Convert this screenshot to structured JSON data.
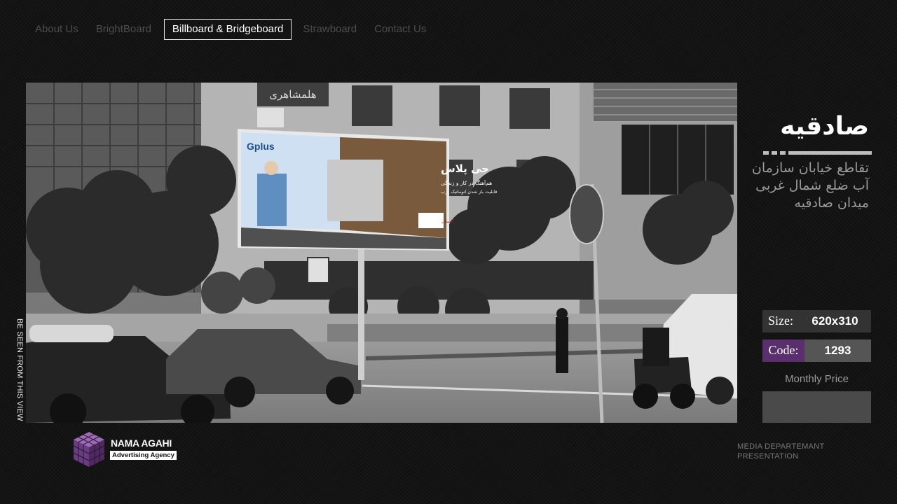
{
  "nav": {
    "items": [
      {
        "label": "About Us"
      },
      {
        "label": "BrightBoard"
      },
      {
        "label": "Billboard & Bridgeboard"
      },
      {
        "label": "Strawboard"
      },
      {
        "label": "Contact Us"
      }
    ],
    "active_index": 2
  },
  "photo": {
    "side_caption": "BE SEEN FROM THIS VIEW",
    "billboard": {
      "brand": "Gplus",
      "headline": "جی پلاس",
      "line1": "هم‌آهنگ در کار و زندگی",
      "line2": "قابلیت باز شدن اتوماتیک درب",
      "badge": "گلستان"
    },
    "building_sign": "هلمشاهری"
  },
  "location": {
    "title": "صادقیه",
    "address_lines": [
      "تقاطع خیابان سازمان",
      "آب ضلع شمال غربی",
      "میدان صادقیه"
    ]
  },
  "specs": {
    "size_label": "Size:",
    "size_value": "620x310",
    "code_label": "Code:",
    "code_value": "1293",
    "price_label": "Monthly Price",
    "price_value": ""
  },
  "footer": {
    "logo_name": "NAMA AGAHI",
    "logo_tagline": "Advertising Agency",
    "note_line1": "MEDIA DEPARTEMANT",
    "note_line2": "PRESENTATION"
  },
  "colors": {
    "accent_purple": "#5b2f6e",
    "background": "#111111"
  }
}
